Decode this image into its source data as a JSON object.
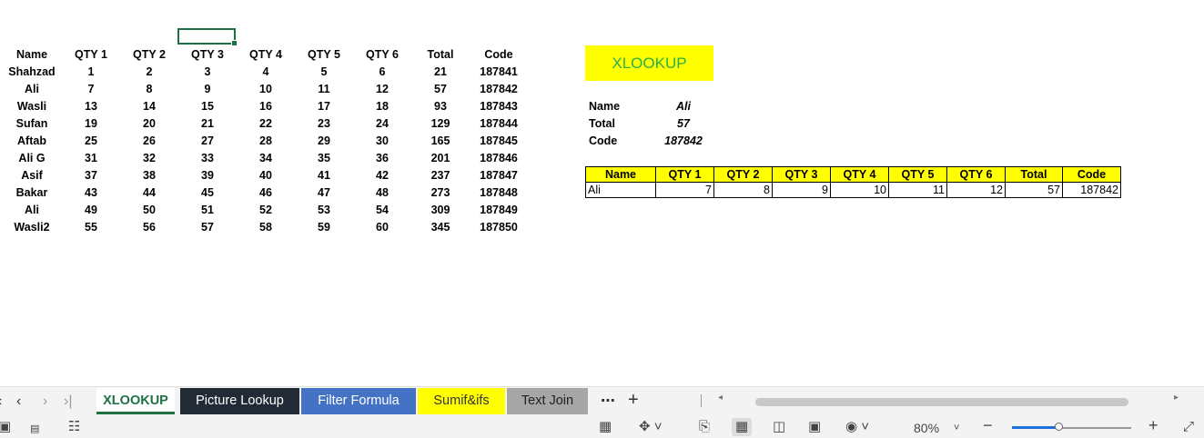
{
  "main_table": {
    "headers": [
      "Name",
      "QTY 1",
      "QTY 2",
      "QTY 3",
      "QTY 4",
      "QTY 5",
      "QTY 6",
      "Total",
      "Code"
    ],
    "rows": [
      [
        "Shahzad",
        "1",
        "2",
        "3",
        "4",
        "5",
        "6",
        "21",
        "187841"
      ],
      [
        "Ali",
        "7",
        "8",
        "9",
        "10",
        "11",
        "12",
        "57",
        "187842"
      ],
      [
        "Wasli",
        "13",
        "14",
        "15",
        "16",
        "17",
        "18",
        "93",
        "187843"
      ],
      [
        "Sufan",
        "19",
        "20",
        "21",
        "22",
        "23",
        "24",
        "129",
        "187844"
      ],
      [
        "Aftab",
        "25",
        "26",
        "27",
        "28",
        "29",
        "30",
        "165",
        "187845"
      ],
      [
        "Ali G",
        "31",
        "32",
        "33",
        "34",
        "35",
        "36",
        "201",
        "187846"
      ],
      [
        "Asif",
        "37",
        "38",
        "39",
        "40",
        "41",
        "42",
        "237",
        "187847"
      ],
      [
        "Bakar",
        "43",
        "44",
        "45",
        "46",
        "47",
        "48",
        "273",
        "187848"
      ],
      [
        "Ali",
        "49",
        "50",
        "51",
        "52",
        "53",
        "54",
        "309",
        "187849"
      ],
      [
        "Wasli2",
        "55",
        "56",
        "57",
        "58",
        "59",
        "60",
        "345",
        "187850"
      ]
    ]
  },
  "xlookup_box": {
    "label": "XLOOKUP"
  },
  "lookup_info": {
    "name_label": "Name",
    "name_value": "Ali",
    "total_label": "Total",
    "total_value": "57",
    "code_label": "Code",
    "code_value": "187842"
  },
  "result_table": {
    "headers": [
      "Name",
      "QTY 1",
      "QTY 2",
      "QTY 3",
      "QTY 4",
      "QTY 5",
      "QTY 6",
      "Total",
      "Code"
    ],
    "row": [
      "Ali",
      "7",
      "8",
      "9",
      "10",
      "11",
      "12",
      "57",
      "187842"
    ]
  },
  "sheet_tabs": [
    {
      "label": "XLOOKUP",
      "active": true,
      "bg": "#ffffff",
      "fg": "#1e7145"
    },
    {
      "label": "Picture Lookup",
      "active": false,
      "bg": "#222a35",
      "fg": "#ffffff"
    },
    {
      "label": "Filter Formula",
      "active": false,
      "bg": "#4472c4",
      "fg": "#ffffff"
    },
    {
      "label": "Sumif&ifs",
      "active": false,
      "bg": "#ffff00",
      "fg": "#333333"
    },
    {
      "label": "Text Join",
      "active": false,
      "bg": "#a6a6a6",
      "fg": "#1f1f1f"
    }
  ],
  "tab_nav": {
    "more_label": "⋯",
    "add_label": "+",
    "prev_icon": "chevron-left-icon",
    "next_icon": "chevron-right-icon"
  },
  "status_bar": {
    "zoom_label": "80%",
    "zoom_minus": "−",
    "zoom_plus": "+",
    "zoom_level_percent": 80
  },
  "colors": {
    "accent_green": "#1e7145",
    "lookup_yellow": "#ffff00",
    "lookup_text_green": "#2ab04a",
    "zoom_blue": "#1e6fd9"
  }
}
